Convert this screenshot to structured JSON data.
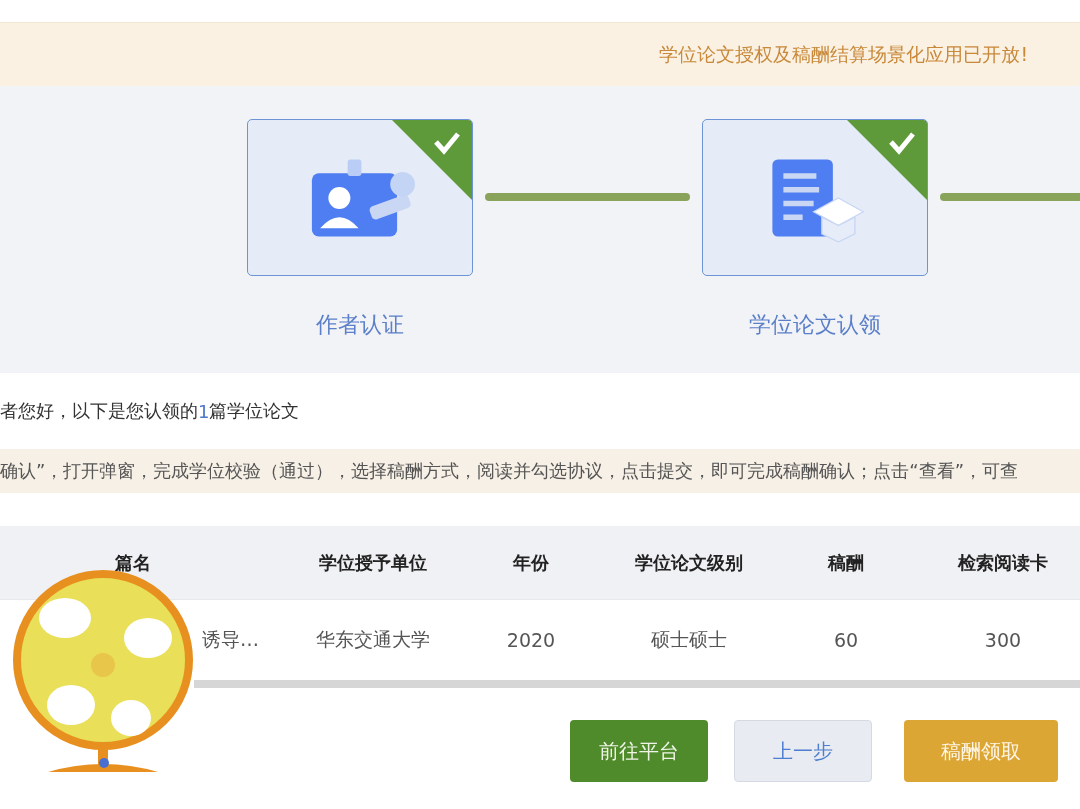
{
  "announcement": "学位论文授权及稿酬结算场景化应用已开放!",
  "steps": [
    {
      "label": "作者认证",
      "kind": "id-card",
      "completed": true
    },
    {
      "label": "学位论文认领",
      "kind": "document",
      "completed": true
    }
  ],
  "greeting": {
    "prefix": "者您好，以下是您认领的",
    "count": "1",
    "suffix": "篇学位论文"
  },
  "notice": "确认”，打开弹窗，完成学位校验（通过），选择稿酬方式，阅读并勾选协议，点击提交，即可完成稿酬确认；点击“查看”，可查",
  "table": {
    "columns": [
      "篇名",
      "学位授予单位",
      "年份",
      "学位论文级别",
      "稿酬",
      "检索阅读卡"
    ],
    "rows": [
      [
        "诱导…",
        "华东交通大学",
        "2020",
        "硕士硕士",
        "60",
        "300"
      ]
    ]
  },
  "buttons": [
    {
      "label": "前往平台",
      "kind": "green"
    },
    {
      "label": "上一步",
      "kind": "plain"
    },
    {
      "label": "稿酬领取",
      "kind": "gold"
    }
  ]
}
